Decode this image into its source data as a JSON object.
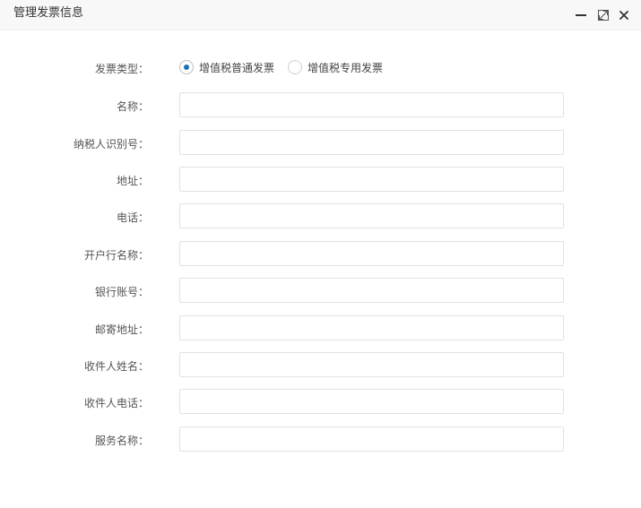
{
  "dialog": {
    "title": "管理发票信息",
    "controls": {
      "minimize_icon": "minimize-icon",
      "maximize_icon": "maximize-icon",
      "close_icon": "close-icon"
    }
  },
  "form": {
    "invoice_type": {
      "label": "发票类型：",
      "options": [
        {
          "text": "增值税普通发票",
          "checked": true
        },
        {
          "text": "增值税专用发票",
          "checked": false
        }
      ]
    },
    "fields": [
      {
        "label": "名称：",
        "value": ""
      },
      {
        "label": "纳税人识别号：",
        "value": ""
      },
      {
        "label": "地址：",
        "value": ""
      },
      {
        "label": "电话：",
        "value": ""
      },
      {
        "label": "开户行名称：",
        "value": ""
      },
      {
        "label": "银行账号：",
        "value": ""
      },
      {
        "label": "邮寄地址：",
        "value": ""
      },
      {
        "label": "收件人姓名：",
        "value": ""
      },
      {
        "label": "收件人电话：",
        "value": ""
      },
      {
        "label": "服务名称：",
        "value": ""
      }
    ]
  },
  "colors": {
    "radio_checked": "#1e6fb6",
    "titlebar_bg": "#f8f8f8",
    "input_border": "#e2e2e2"
  }
}
